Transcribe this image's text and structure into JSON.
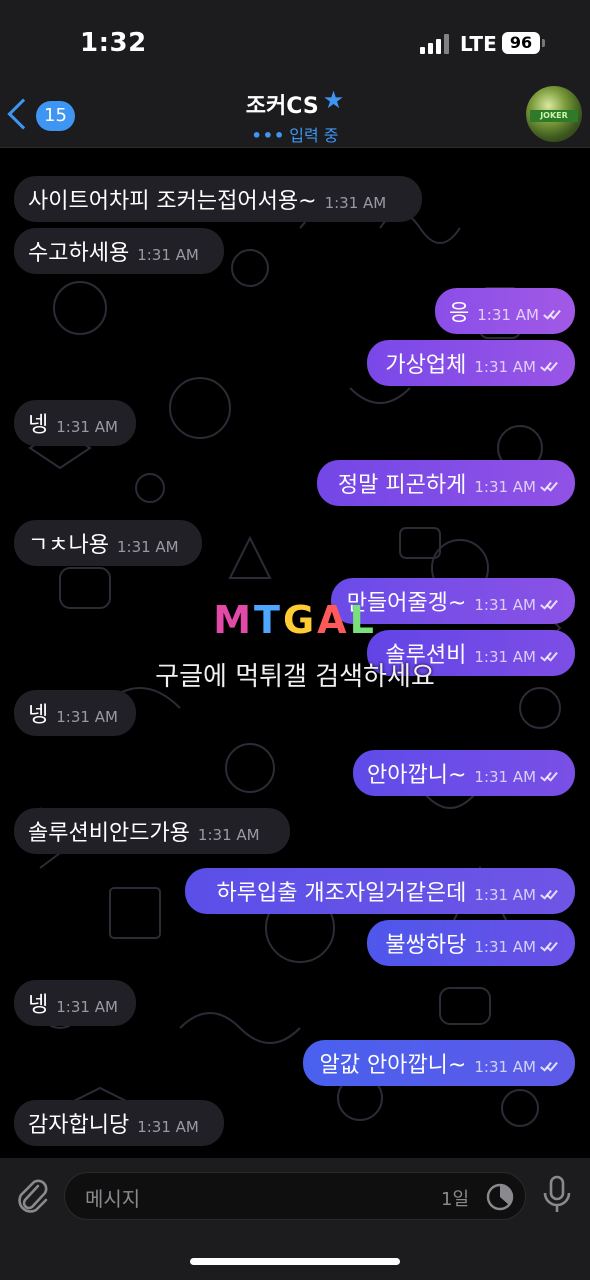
{
  "status": {
    "time": "1:32",
    "network": "LTE",
    "battery": "96"
  },
  "header": {
    "back_count": "15",
    "title": "조커CS",
    "subtitle": "입력 중",
    "accent_color": "#3e96f2"
  },
  "messages": [
    {
      "dir": "in",
      "text": "사이트어차피 조커는접어서용~",
      "time": "1:31 AM"
    },
    {
      "dir": "in",
      "text": "수고하세용",
      "time": "1:31 AM"
    },
    {
      "dir": "out",
      "text": "응",
      "time": "1:31 AM",
      "read": true
    },
    {
      "dir": "out",
      "text": "가상업체",
      "time": "1:31 AM",
      "read": true
    },
    {
      "dir": "in",
      "text": "넹",
      "time": "1:31 AM"
    },
    {
      "dir": "out",
      "text": "정말 피곤하게",
      "time": "1:31 AM",
      "read": true
    },
    {
      "dir": "in",
      "text": "ㄱㅊ나용",
      "time": "1:31 AM"
    },
    {
      "dir": "out",
      "text": "만들어줄겡~",
      "time": "1:31 AM",
      "read": true
    },
    {
      "dir": "out",
      "text": "솔루션비",
      "time": "1:31 AM",
      "read": true
    },
    {
      "dir": "in",
      "text": "넹",
      "time": "1:31 AM"
    },
    {
      "dir": "out",
      "text": "안아깝니~",
      "time": "1:31 AM",
      "read": true
    },
    {
      "dir": "in",
      "text": "솔루션비안드가용",
      "time": "1:31 AM"
    },
    {
      "dir": "out",
      "text": "하루입출 개조자일거같은데",
      "time": "1:31 AM",
      "read": true
    },
    {
      "dir": "out",
      "text": "불쌍하당",
      "time": "1:31 AM",
      "read": true
    },
    {
      "dir": "in",
      "text": "넹",
      "time": "1:31 AM"
    },
    {
      "dir": "out",
      "text": "알값 안아깝니~",
      "time": "1:31 AM",
      "read": true
    },
    {
      "dir": "in",
      "text": "감자합니당",
      "time": "1:31 AM"
    }
  ],
  "watermark": {
    "logo": "MTGAL",
    "text": "구글에 먹튀갤 검색하세요"
  },
  "composer": {
    "placeholder": "메시지",
    "timer_label": "1일"
  },
  "icons": {
    "back": "chevron-left-icon",
    "verified": "star-icon",
    "attach": "paperclip-icon",
    "timer": "timer-icon",
    "mic": "microphone-icon"
  }
}
